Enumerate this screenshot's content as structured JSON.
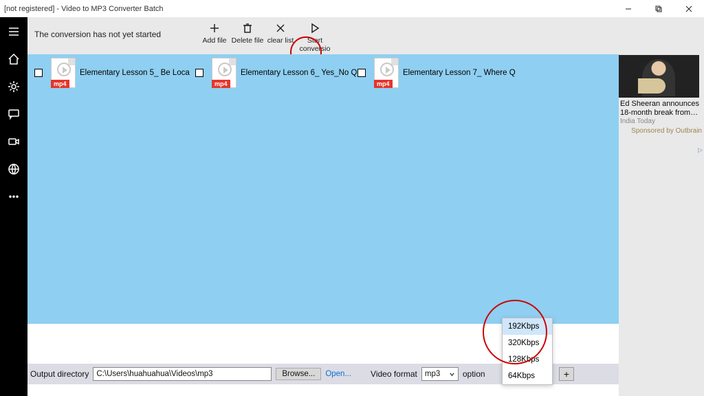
{
  "titlebar": {
    "title": "[not registered] - Video to MP3 Converter Batch"
  },
  "toolbar": {
    "status": "The conversion has not yet started",
    "add_file": "Add file",
    "delete_file": "Delete file",
    "clear_list": "clear list",
    "start_conversion": "Start conversio"
  },
  "files": [
    {
      "name": "Elementary Lesson 5_ Be   Loca",
      "badge": "mp4"
    },
    {
      "name": "Elementary Lesson 6_ Yes_No Q",
      "badge": "mp4"
    },
    {
      "name": "Elementary Lesson 7_ Where Q",
      "badge": "mp4"
    }
  ],
  "bottom": {
    "outdir_label": "Output directory",
    "outdir_value": "C:\\Users\\huahuahua\\Videos\\mp3",
    "browse": "Browse...",
    "open": "Open...",
    "vformat_label": "Video format",
    "vformat_value": "mp3",
    "option_label": "option",
    "plus": "+"
  },
  "bitrate_options": [
    "192Kbps",
    "320Kbps",
    "128Kbps",
    "64Kbps"
  ],
  "bitrate_selected": "192Kbps",
  "ad": {
    "headline": "Ed Sheeran announces 18-month break from…",
    "source": "India Today",
    "sponsored": "Sponsored by Outbrain"
  }
}
